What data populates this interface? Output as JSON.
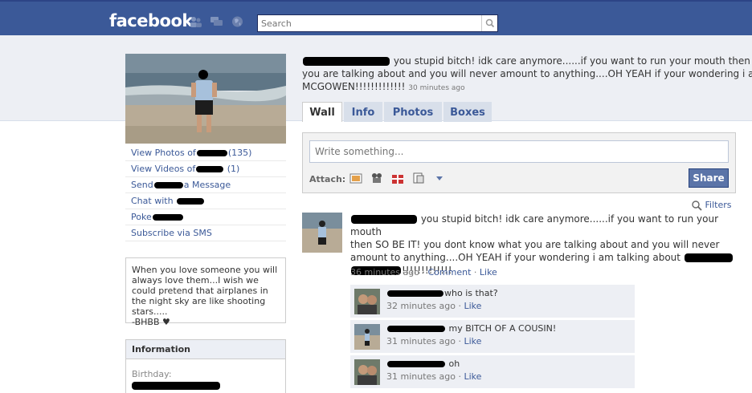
{
  "header": {
    "logo": "facebook",
    "search_placeholder": "Search"
  },
  "left": {
    "links": {
      "photos_prefix": "View Photos of",
      "photos_count": "(135)",
      "videos_prefix": "View Videos of",
      "videos_count": "(1)",
      "message_prefix": "Send",
      "message_suffix": "a Message",
      "chat_prefix": "Chat with",
      "poke_prefix": "Poke",
      "sms": "Subscribe via SMS"
    },
    "quote": "When you love someone you will always love them...I wish we could pretend that airplanes in the night sky are like shooting stars.....",
    "quote_sig": "-BHBB ♥",
    "info_title": "Information",
    "info_birthday_label": "Birthday:"
  },
  "status": {
    "line1": "you stupid bitch! idk care anymore......if you want to run your mouth then SO BE IT!",
    "line2": "you are talking about and you will never amount to anything....OH YEAH if your wondering i am talking about",
    "line3": "MCGOWEN!!!!!!!!!!!!!",
    "time": "30 minutes ago"
  },
  "tabs": [
    {
      "label": "Wall"
    },
    {
      "label": "Info"
    },
    {
      "label": "Photos"
    },
    {
      "label": "Boxes"
    }
  ],
  "composer": {
    "placeholder": "Write something...",
    "attach_label": "Attach:",
    "share_label": "Share"
  },
  "filters_label": "Filters",
  "story": {
    "line1": "you stupid bitch! idk care anymore......if you want to run your mouth",
    "line2": "then SO BE IT! you dont know what you are talking about and you will never",
    "line3": "amount to anything....OH YEAH if your wondering i am talking about",
    "line4_suffix": "!!!!!!!!!!!!!",
    "time": "36 minutes ago",
    "comment_label": "Comment",
    "like_label": "Like"
  },
  "comments": [
    {
      "text": "who is that?",
      "time": "32 minutes ago",
      "like": "Like"
    },
    {
      "text": "my BITCH OF A COUSIN!",
      "time": "31 minutes ago",
      "like": "Like"
    },
    {
      "text": "oh",
      "time": "31 minutes ago",
      "like": "Like"
    }
  ],
  "colors": {
    "brand_blue": "#3b5998",
    "band_grey": "#edeff4",
    "share_button": "#5b74a8"
  }
}
